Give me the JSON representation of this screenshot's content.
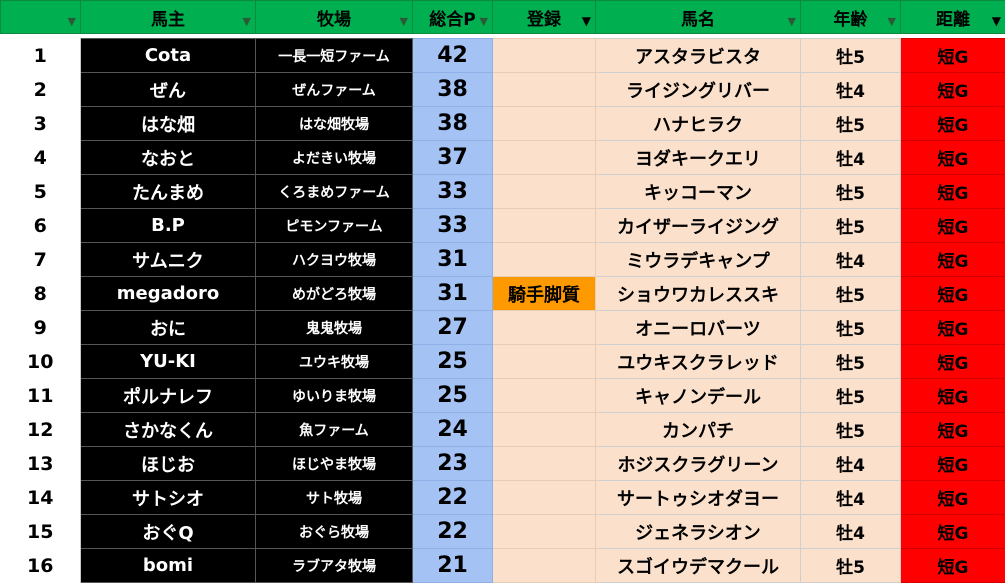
{
  "headers": {
    "rank": "",
    "owner": "馬主",
    "farm": "牧場",
    "points": "総合P",
    "registration": "登録",
    "horse": "馬名",
    "age": "年齢",
    "distance": "距離"
  },
  "colors": {
    "header_bg": "#00b050",
    "owner_bg": "#000000",
    "points_bg": "#a4c2f4",
    "horse_bg": "#fbe1cc",
    "registration_flag_bg": "#ff9900",
    "distance_bg": "#ff0000"
  },
  "rows": [
    {
      "rank": "1",
      "owner": "Cota",
      "farm": "一長一短ファーム",
      "points": "42",
      "registration": "",
      "horse": "アスタラビスタ",
      "age": "牡5",
      "distance": "短G"
    },
    {
      "rank": "2",
      "owner": "ぜん",
      "farm": "ぜんファーム",
      "points": "38",
      "registration": "",
      "horse": "ライジングリバー",
      "age": "牡4",
      "distance": "短G"
    },
    {
      "rank": "3",
      "owner": "はな畑",
      "farm": "はな畑牧場",
      "points": "38",
      "registration": "",
      "horse": "ハナヒラク",
      "age": "牡5",
      "distance": "短G"
    },
    {
      "rank": "4",
      "owner": "なおと",
      "farm": "よだきい牧場",
      "points": "37",
      "registration": "",
      "horse": "ヨダキークエリ",
      "age": "牡4",
      "distance": "短G"
    },
    {
      "rank": "5",
      "owner": "たんまめ",
      "farm": "くろまめファーム",
      "points": "33",
      "registration": "",
      "horse": "キッコーマン",
      "age": "牡5",
      "distance": "短G"
    },
    {
      "rank": "6",
      "owner": "B.P",
      "farm": "ピモンファーム",
      "points": "33",
      "registration": "",
      "horse": "カイザーライジング",
      "age": "牡5",
      "distance": "短G"
    },
    {
      "rank": "7",
      "owner": "サムニク",
      "farm": "ハクヨウ牧場",
      "points": "31",
      "registration": "",
      "horse": "ミウラデキャンプ",
      "age": "牡4",
      "distance": "短G"
    },
    {
      "rank": "8",
      "owner": "megadoro",
      "farm": "めがどろ牧場",
      "points": "31",
      "registration": "騎手脚質",
      "horse": "ショウワカレススキ",
      "age": "牡5",
      "distance": "短G"
    },
    {
      "rank": "9",
      "owner": "おに",
      "farm": "鬼鬼牧場",
      "points": "27",
      "registration": "",
      "horse": "オニーロバーツ",
      "age": "牡5",
      "distance": "短G"
    },
    {
      "rank": "10",
      "owner": "YU-KI",
      "farm": "ユウキ牧場",
      "points": "25",
      "registration": "",
      "horse": "ユウキスクラレッド",
      "age": "牡5",
      "distance": "短G"
    },
    {
      "rank": "11",
      "owner": "ポルナレフ",
      "farm": "ゆいりま牧場",
      "points": "25",
      "registration": "",
      "horse": "キャノンデール",
      "age": "牡5",
      "distance": "短G"
    },
    {
      "rank": "12",
      "owner": "さかなくん",
      "farm": "魚ファーム",
      "points": "24",
      "registration": "",
      "horse": "カンパチ",
      "age": "牡5",
      "distance": "短G"
    },
    {
      "rank": "13",
      "owner": "ほじお",
      "farm": "ほじやま牧場",
      "points": "23",
      "registration": "",
      "horse": "ホジスクラグリーン",
      "age": "牡4",
      "distance": "短G"
    },
    {
      "rank": "14",
      "owner": "サトシオ",
      "farm": "サト牧場",
      "points": "22",
      "registration": "",
      "horse": "サートゥシオダヨー",
      "age": "牡4",
      "distance": "短G"
    },
    {
      "rank": "15",
      "owner": "おぐQ",
      "farm": "おぐら牧場",
      "points": "22",
      "registration": "",
      "horse": "ジェネラシオン",
      "age": "牡4",
      "distance": "短G"
    },
    {
      "rank": "16",
      "owner": "bomi",
      "farm": "ラブアタ牧場",
      "points": "21",
      "registration": "",
      "horse": "スゴイウデマクール",
      "age": "牡5",
      "distance": "短G"
    }
  ]
}
